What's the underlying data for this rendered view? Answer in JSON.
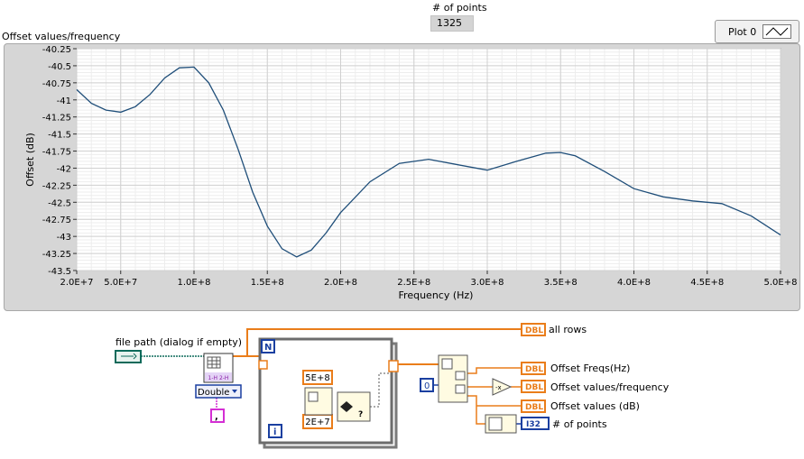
{
  "points_indicator": {
    "label": "# of points",
    "value": "1325"
  },
  "graph": {
    "title": "Offset values/frequency"
  },
  "legend": {
    "label": "Plot 0"
  },
  "chart_data": {
    "type": "line",
    "xlabel": "Frequency (Hz)",
    "ylabel": "Offset (dB)",
    "xlim": [
      20000000,
      500000000
    ],
    "ylim": [
      -43.5,
      -40.25
    ],
    "x_ticks": [
      "2.0E+7",
      "5.0E+7",
      "1.0E+8",
      "1.5E+8",
      "2.0E+8",
      "2.5E+8",
      "3.0E+8",
      "3.5E+8",
      "4.0E+8",
      "4.5E+8",
      "5.0E+8"
    ],
    "y_ticks": [
      "-40.25",
      "-40.5",
      "-40.75",
      "-41",
      "-41.25",
      "-41.5",
      "-41.75",
      "-42",
      "-42.25",
      "-42.5",
      "-42.75",
      "-43",
      "-43.25",
      "-43.5"
    ],
    "grid": true,
    "line_color": "#1f4e79",
    "series": [
      {
        "name": "Plot 0",
        "x": [
          20000000,
          30000000,
          40000000,
          50000000,
          60000000,
          70000000,
          80000000,
          90000000,
          100000000,
          110000000,
          120000000,
          130000000,
          140000000,
          150000000,
          160000000,
          170000000,
          180000000,
          190000000,
          200000000,
          220000000,
          240000000,
          260000000,
          280000000,
          300000000,
          320000000,
          340000000,
          350000000,
          360000000,
          380000000,
          400000000,
          420000000,
          440000000,
          460000000,
          480000000,
          500000000
        ],
        "values": [
          -40.85,
          -41.05,
          -41.15,
          -41.18,
          -41.1,
          -40.92,
          -40.68,
          -40.53,
          -40.52,
          -40.75,
          -41.15,
          -41.72,
          -42.35,
          -42.85,
          -43.18,
          -43.3,
          -43.2,
          -42.95,
          -42.65,
          -42.2,
          -41.93,
          -41.87,
          -41.95,
          -42.03,
          -41.9,
          -41.78,
          -41.77,
          -41.82,
          -42.05,
          -42.3,
          -42.42,
          -42.48,
          -42.52,
          -42.7,
          -42.98
        ]
      }
    ]
  },
  "diagram": {
    "file_path_label": "file path (dialog if empty)",
    "type_selector": "Double",
    "delimiter": ",",
    "const_start": "5E+8",
    "const_end": "2E+7",
    "loop_count": "N",
    "loop_index": "i",
    "index_const": "0",
    "dbl_tag": "DBL",
    "i32_tag": "I32",
    "ind_all_rows": "all rows",
    "ind_freqs": "Offset Freqs(Hz)",
    "ind_values_freq": "Offset values/frequency",
    "ind_values_db": "Offset values (dB)",
    "ind_points": "# of points"
  }
}
